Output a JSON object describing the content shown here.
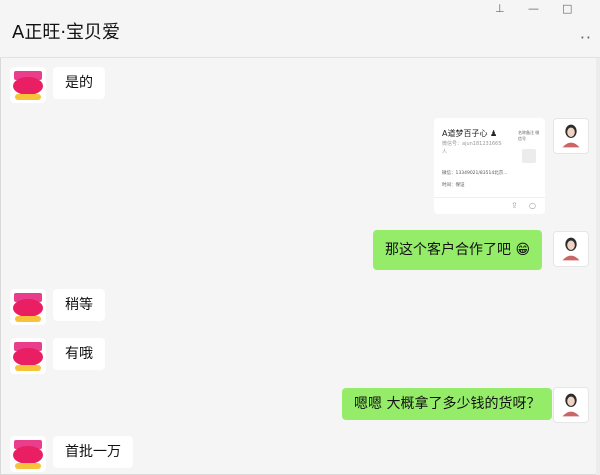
{
  "window": {
    "title": "A正旺·宝贝爱",
    "pin_icon": "pin-icon",
    "minimize_icon": "minimize-icon",
    "maximize_icon": "maximize-icon",
    "more_icon": "more-icon"
  },
  "messages": [
    {
      "from": "other",
      "text": "是的"
    },
    {
      "from": "self",
      "type": "contact-card"
    },
    {
      "from": "self",
      "text": "那这个客户合作了吧 😁"
    },
    {
      "from": "other",
      "text": "稍等"
    },
    {
      "from": "other",
      "text": "有哦"
    },
    {
      "from": "self",
      "text": "嗯嗯 大概拿了多少钱的货呀？"
    },
    {
      "from": "other",
      "text": "首批一万"
    }
  ],
  "contact_card": {
    "name": "A道梦百子心 ♟",
    "account_line": "微信号：ajun1812316658",
    "sub_line": "人",
    "side_text": "名称备注 微信号",
    "row1": "微信：13349021/83514北京...",
    "row2": "时间：保证"
  },
  "colors": {
    "outgoing_bubble": "#95ec69",
    "incoming_bubble": "#ffffff",
    "background": "#f5f5f5"
  }
}
